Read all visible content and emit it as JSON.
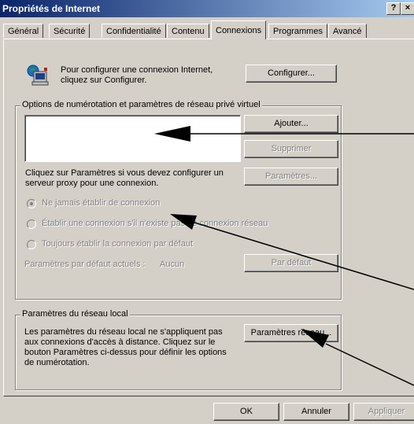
{
  "window": {
    "title": "Propriétés de Internet",
    "help_glyph": "?",
    "close_glyph": "×"
  },
  "tabs": [
    {
      "label": "Général",
      "active": false
    },
    {
      "label": "Sécurité",
      "active": false
    },
    {
      "label": "Confidentialité",
      "active": false
    },
    {
      "label": "Contenu",
      "active": false
    },
    {
      "label": "Connexions",
      "active": true
    },
    {
      "label": "Programmes",
      "active": false
    },
    {
      "label": "Avancé",
      "active": false
    }
  ],
  "setup": {
    "icon": "network-computer-icon",
    "text": "Pour configurer une connexion Internet, cliquez sur Configurer.",
    "button": "Configurer..."
  },
  "dialup": {
    "legend": "Options de numérotation et paramètres de réseau privé virtuel",
    "add_button": "Ajouter...",
    "remove_button": "Supprimer",
    "proxy_text": "Cliquez sur Paramètres si vous devez configurer un serveur proxy pour une connexion.",
    "settings_button": "Paramètres...",
    "radio_never": "Ne jamais établir de connexion",
    "radio_when_no_network": "Établir une connexion s'il n'existe pas de connexion réseau",
    "radio_always": "Toujours établir la connexion par défaut",
    "current_default_label": "Paramètres par défaut actuels :",
    "current_default_value": "Aucun",
    "default_button": "Par défaut"
  },
  "lan": {
    "legend": "Paramètres du réseau local",
    "text": "Les paramètres du réseau local ne s'appliquent pas aux connexions d'accès à distance. Cliquez sur le bouton Paramètres ci-dessus pour définir les options de numérotation.",
    "button": "Paramètres réseau..."
  },
  "footer": {
    "ok": "OK",
    "cancel": "Annuler",
    "apply": "Appliquer"
  },
  "colors": {
    "face": "#d4d0c8",
    "title_start": "#0a246a",
    "title_end": "#a6caf0",
    "disabled_text": "#808080"
  }
}
